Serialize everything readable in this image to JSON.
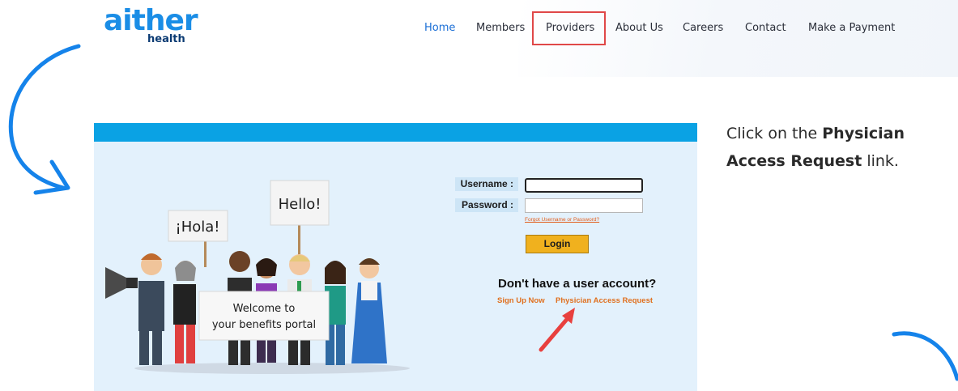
{
  "logo": {
    "main": "aither",
    "sub": "health"
  },
  "nav": {
    "items": [
      {
        "label": "Home",
        "active": true
      },
      {
        "label": "Members"
      },
      {
        "label": "Providers",
        "highlighted": true
      },
      {
        "label": "About Us"
      },
      {
        "label": "Careers"
      },
      {
        "label": "Contact"
      },
      {
        "label": "Make a Payment"
      }
    ]
  },
  "portal": {
    "username_label": "Username :",
    "username_value": "",
    "password_label": "Password :",
    "password_value": "",
    "forgot_link": "Forgot Username or Password?",
    "login_button": "Login",
    "no_account_text": "Don't have a user account?",
    "signup_link": "Sign Up Now",
    "physician_link": "Physician Access Request",
    "illustration": {
      "sign_left": "¡Hola!",
      "sign_right": "Hello!",
      "banner_line1": "Welcome to",
      "banner_line2": "your benefits portal"
    }
  },
  "instruction": {
    "prefix": "Click on the ",
    "bold_1": "Physician",
    "bold_2": "Access Request",
    "suffix": " link."
  },
  "colors": {
    "accent_blue": "#1a8de6",
    "portal_bar": "#0aa2e4",
    "portal_bg": "#e3f1fc",
    "link_orange": "#e0701f",
    "button_gold": "#f0b11e",
    "highlight_red": "#e04848",
    "arrow_red": "#e8403e"
  }
}
